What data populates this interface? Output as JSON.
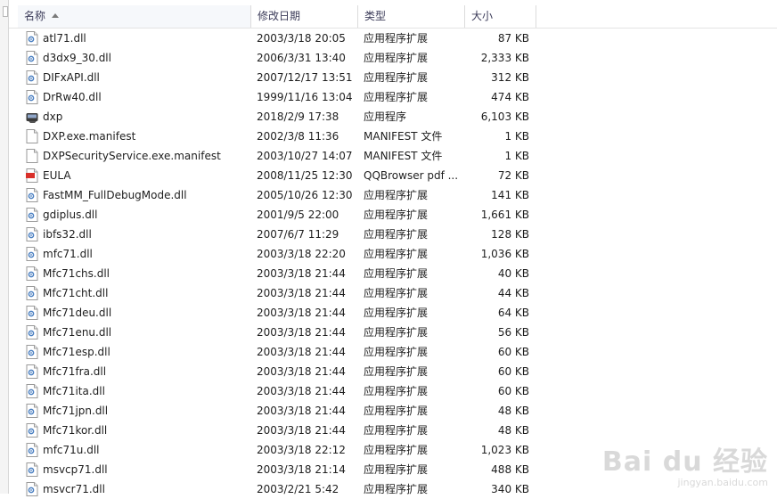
{
  "columns": {
    "name": "名称",
    "date": "修改日期",
    "type": "类型",
    "size": "大小"
  },
  "files": [
    {
      "name": "atl71.dll",
      "date": "2003/3/18 20:05",
      "type": "应用程序扩展",
      "size": "87 KB",
      "icon": "dll-file-icon"
    },
    {
      "name": "d3dx9_30.dll",
      "date": "2006/3/31 13:40",
      "type": "应用程序扩展",
      "size": "2,333 KB",
      "icon": "dll-file-icon"
    },
    {
      "name": "DIFxAPI.dll",
      "date": "2007/12/17 13:51",
      "type": "应用程序扩展",
      "size": "312 KB",
      "icon": "dll-file-icon"
    },
    {
      "name": "DrRw40.dll",
      "date": "1999/11/16 13:04",
      "type": "应用程序扩展",
      "size": "474 KB",
      "icon": "dll-file-icon"
    },
    {
      "name": "dxp",
      "date": "2018/2/9 17:38",
      "type": "应用程序",
      "size": "6,103 KB",
      "icon": "application-icon"
    },
    {
      "name": "DXP.exe.manifest",
      "date": "2002/3/8 11:36",
      "type": "MANIFEST 文件",
      "size": "1 KB",
      "icon": "blank-file-icon"
    },
    {
      "name": "DXPSecurityService.exe.manifest",
      "date": "2003/10/27 14:07",
      "type": "MANIFEST 文件",
      "size": "1 KB",
      "icon": "blank-file-icon"
    },
    {
      "name": "EULA",
      "date": "2008/11/25 12:30",
      "type": "QQBrowser pdf ...",
      "size": "72 KB",
      "icon": "pdf-file-icon"
    },
    {
      "name": "FastMM_FullDebugMode.dll",
      "date": "2005/10/26 12:30",
      "type": "应用程序扩展",
      "size": "141 KB",
      "icon": "dll-file-icon"
    },
    {
      "name": "gdiplus.dll",
      "date": "2001/9/5 22:00",
      "type": "应用程序扩展",
      "size": "1,661 KB",
      "icon": "dll-file-icon"
    },
    {
      "name": "ibfs32.dll",
      "date": "2007/6/7 11:29",
      "type": "应用程序扩展",
      "size": "128 KB",
      "icon": "dll-file-icon"
    },
    {
      "name": "mfc71.dll",
      "date": "2003/3/18 22:20",
      "type": "应用程序扩展",
      "size": "1,036 KB",
      "icon": "dll-file-icon"
    },
    {
      "name": "Mfc71chs.dll",
      "date": "2003/3/18 21:44",
      "type": "应用程序扩展",
      "size": "40 KB",
      "icon": "dll-file-icon"
    },
    {
      "name": "Mfc71cht.dll",
      "date": "2003/3/18 21:44",
      "type": "应用程序扩展",
      "size": "44 KB",
      "icon": "dll-file-icon"
    },
    {
      "name": "Mfc71deu.dll",
      "date": "2003/3/18 21:44",
      "type": "应用程序扩展",
      "size": "64 KB",
      "icon": "dll-file-icon"
    },
    {
      "name": "Mfc71enu.dll",
      "date": "2003/3/18 21:44",
      "type": "应用程序扩展",
      "size": "56 KB",
      "icon": "dll-file-icon"
    },
    {
      "name": "Mfc71esp.dll",
      "date": "2003/3/18 21:44",
      "type": "应用程序扩展",
      "size": "60 KB",
      "icon": "dll-file-icon"
    },
    {
      "name": "Mfc71fra.dll",
      "date": "2003/3/18 21:44",
      "type": "应用程序扩展",
      "size": "60 KB",
      "icon": "dll-file-icon"
    },
    {
      "name": "Mfc71ita.dll",
      "date": "2003/3/18 21:44",
      "type": "应用程序扩展",
      "size": "60 KB",
      "icon": "dll-file-icon"
    },
    {
      "name": "Mfc71jpn.dll",
      "date": "2003/3/18 21:44",
      "type": "应用程序扩展",
      "size": "48 KB",
      "icon": "dll-file-icon"
    },
    {
      "name": "Mfc71kor.dll",
      "date": "2003/3/18 21:44",
      "type": "应用程序扩展",
      "size": "48 KB",
      "icon": "dll-file-icon"
    },
    {
      "name": "mfc71u.dll",
      "date": "2003/3/18 22:12",
      "type": "应用程序扩展",
      "size": "1,023 KB",
      "icon": "dll-file-icon"
    },
    {
      "name": "msvcp71.dll",
      "date": "2003/3/18 21:14",
      "type": "应用程序扩展",
      "size": "488 KB",
      "icon": "dll-file-icon"
    },
    {
      "name": "msvcr71.dll",
      "date": "2003/2/21 5:42",
      "type": "应用程序扩展",
      "size": "340 KB",
      "icon": "dll-file-icon"
    }
  ],
  "watermark": {
    "logo": "Bai du 经验",
    "url": "jingyan.baidu.com"
  },
  "colors": {
    "header_text": "#3c3c5a",
    "pdf_red": "#d9302a",
    "dll_blue": "#4a7fc1"
  }
}
